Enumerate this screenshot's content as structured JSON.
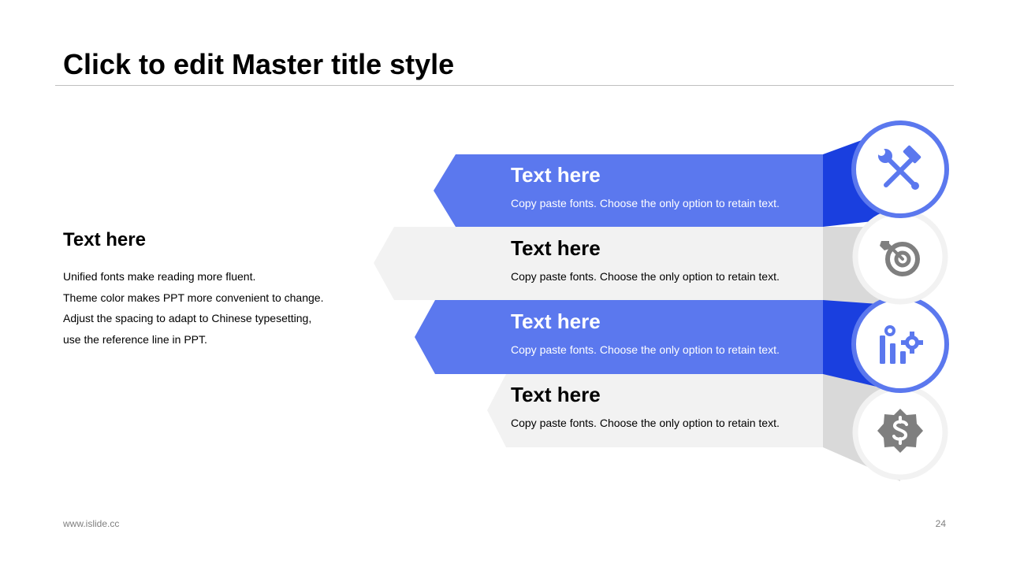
{
  "slide": {
    "title": "Click to edit Master title style"
  },
  "intro": {
    "heading": "Text here",
    "lines": [
      "Unified fonts make reading more fluent.",
      "Theme color makes PPT more convenient to change.",
      "Adjust the spacing to adapt to Chinese typesetting,",
      "use the reference line in PPT."
    ]
  },
  "items": [
    {
      "title": "Text here",
      "description": "Copy paste fonts. Choose the only option to retain text.",
      "icon": "tools-icon",
      "style": "primary"
    },
    {
      "title": "Text here",
      "description": "Copy paste fonts. Choose the only option to retain text.",
      "icon": "target-icon",
      "style": "neutral"
    },
    {
      "title": "Text here",
      "description": "Copy paste fonts. Choose the only option to retain text.",
      "icon": "chart-gear-icon",
      "style": "primary"
    },
    {
      "title": "Text here",
      "description": "Copy paste fonts. Choose the only option to retain text.",
      "icon": "dollar-badge-icon",
      "style": "neutral"
    }
  ],
  "footer": {
    "website": "www.islide.cc",
    "page_number": "24"
  },
  "colors": {
    "primary": "#5b78ee",
    "primary_dark": "#1a3fdf",
    "neutral_band": "#f2f2f2",
    "neutral_dark": "#d9d9d9",
    "neutral_ring": "#f2f2f2",
    "neutral_icon": "#7f7f7f"
  }
}
